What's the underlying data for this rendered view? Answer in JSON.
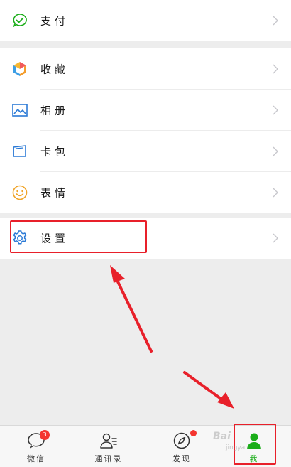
{
  "menu": {
    "pay": {
      "label": "支付",
      "icon": "pay-check-icon"
    },
    "favorites": {
      "label": "收藏",
      "icon": "favorites-cube-icon"
    },
    "album": {
      "label": "相册",
      "icon": "album-picture-icon"
    },
    "cards": {
      "label": "卡包",
      "icon": "card-wallet-icon"
    },
    "stickers": {
      "label": "表情",
      "icon": "smiley-icon"
    },
    "settings": {
      "label": "设置",
      "icon": "gear-icon"
    }
  },
  "tabbar": {
    "tabs": [
      {
        "label": "微信",
        "icon": "chat-bubble-icon",
        "badge": "3"
      },
      {
        "label": "通讯录",
        "icon": "contacts-icon"
      },
      {
        "label": "发现",
        "icon": "compass-icon"
      },
      {
        "label": "我",
        "icon": "person-icon"
      }
    ],
    "active_index": 3
  },
  "watermark": {
    "text": "Bai",
    "sub": "jingyan"
  },
  "colors": {
    "accent": "#1aad19",
    "annotation": "#e8202a",
    "badge": "#f43530",
    "background": "#ededed"
  }
}
